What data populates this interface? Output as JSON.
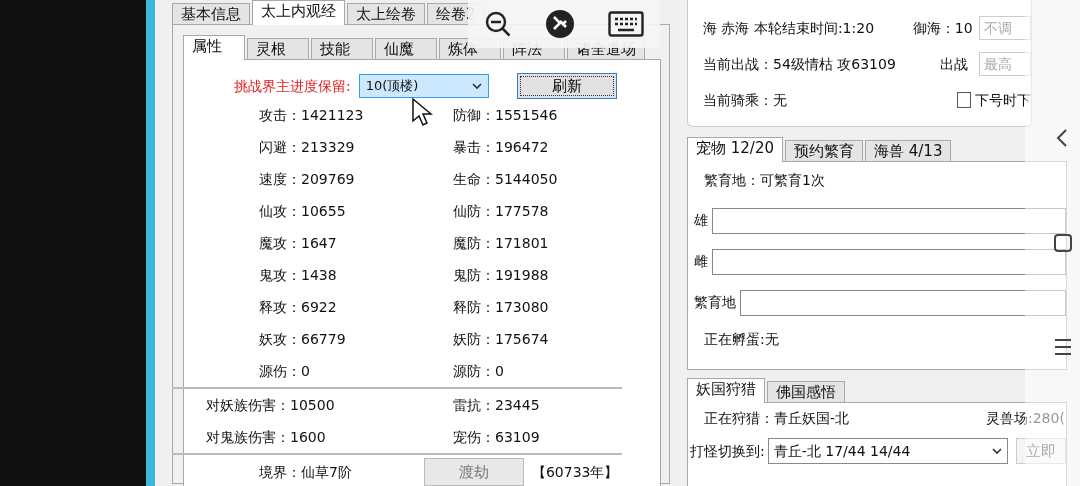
{
  "left_window": {
    "top_tabs": [
      {
        "label": "基本信息",
        "selected": false
      },
      {
        "label": "太上内观经",
        "selected": true
      },
      {
        "label": "太上绘卷",
        "selected": false
      },
      {
        "label": "绘卷2",
        "selected": false
      }
    ],
    "sub_tabs": [
      {
        "label": "属性",
        "selected": true
      },
      {
        "label": "灵根",
        "selected": false
      },
      {
        "label": "技能",
        "selected": false
      },
      {
        "label": "仙魔",
        "selected": false
      },
      {
        "label": "炼体",
        "selected": false
      },
      {
        "label": "阵法",
        "selected": false
      },
      {
        "label": "诸全道场",
        "selected": false
      }
    ],
    "challenge": {
      "label": "挑战界主进度保留:",
      "value": "10(顶楼)"
    },
    "refresh_button": "刷新",
    "stats": [
      "攻击：1421123",
      "防御：1551546",
      "闪避：213329",
      "暴击：196472",
      "速度：209769",
      "生命：5144050",
      "仙攻：10655",
      "仙防：177578",
      "魔攻：1647",
      "魔防：171801",
      "鬼攻：1438",
      "鬼防：191988",
      "释攻：6922",
      "释防：173080",
      "妖攻：66779",
      "妖防：175674",
      "源伤：0",
      "源防：0"
    ],
    "damage_stats": [
      "对妖族伤害：10500",
      "雷抗：23445",
      "对鬼族伤害：1600",
      "宠伤：63109"
    ],
    "realm": "境界：仙草7阶",
    "tribulation_button": "渡劫",
    "years": "【60733年】"
  },
  "right_panel": {
    "sea_info": "海 赤海 本轮结束时间:1:20",
    "sea_control": {
      "label": "御海：10",
      "value": "不调"
    },
    "current_battle": "当前出战：54级情枯 攻63109",
    "battle_control": {
      "label": "出战",
      "value": "最高"
    },
    "current_mount": "当前骑乘：无",
    "logout_option": {
      "label": "下号时下",
      "checked": false
    },
    "pet_tabs": [
      {
        "label": "宠物 12/20",
        "selected": true
      },
      {
        "label": "预约繁育",
        "selected": false
      },
      {
        "label": "海兽 4/13",
        "selected": false
      }
    ],
    "breeding_status": "繁育地：可繁育1次",
    "breeding_fields": [
      {
        "label": "雄"
      },
      {
        "label": "雌"
      },
      {
        "label": "繁育地"
      }
    ],
    "hatching": "正在孵蛋:无",
    "hunt_tabs": [
      {
        "label": "妖国狩猎",
        "selected": true
      },
      {
        "label": "佛国感悟",
        "selected": false
      }
    ],
    "hunting": "正在狩猎：青丘妖国-北",
    "beast_field": "灵兽场:280(",
    "switch": {
      "label": "打怪切换到:",
      "value": "青丘-北 17/44 14/44"
    },
    "now_button": "立即"
  }
}
